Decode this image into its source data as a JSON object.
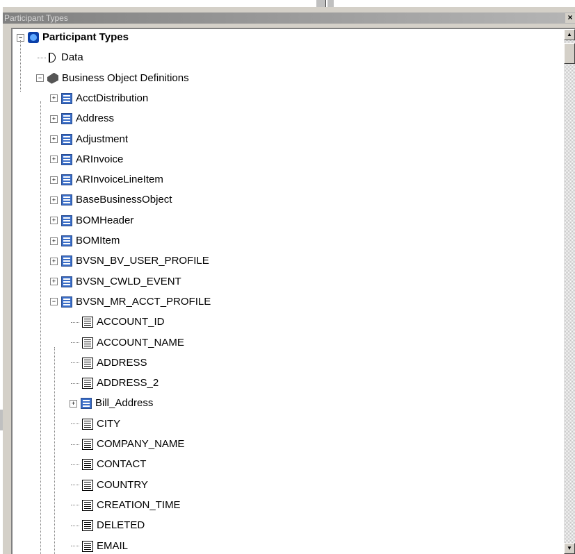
{
  "window": {
    "title": "Participant Types",
    "close_glyph": "×"
  },
  "tree": {
    "root": {
      "label": "Participant Types",
      "icon": "participant-root-icon",
      "expander": "−"
    },
    "items": [
      {
        "label": "Data",
        "icon": "data-icon",
        "level": 1
      },
      {
        "label": "Business Object Definitions",
        "icon": "business-objects-icon",
        "level": 1,
        "expander": "−"
      },
      {
        "label": "AcctDistribution",
        "icon": "bo-icon",
        "level": 2,
        "expander": "+"
      },
      {
        "label": "Address",
        "icon": "bo-icon",
        "level": 2,
        "expander": "+"
      },
      {
        "label": "Adjustment",
        "icon": "bo-icon",
        "level": 2,
        "expander": "+"
      },
      {
        "label": "ARInvoice",
        "icon": "bo-icon",
        "level": 2,
        "expander": "+"
      },
      {
        "label": "ARInvoiceLineItem",
        "icon": "bo-icon",
        "level": 2,
        "expander": "+"
      },
      {
        "label": "BaseBusinessObject",
        "icon": "bo-icon",
        "level": 2,
        "expander": "+"
      },
      {
        "label": "BOMHeader",
        "icon": "bo-icon",
        "level": 2,
        "expander": "+"
      },
      {
        "label": "BOMItem",
        "icon": "bo-icon",
        "level": 2,
        "expander": "+"
      },
      {
        "label": "BVSN_BV_USER_PROFILE",
        "icon": "bo-icon",
        "level": 2,
        "expander": "+"
      },
      {
        "label": "BVSN_CWLD_EVENT",
        "icon": "bo-icon",
        "level": 2,
        "expander": "+"
      },
      {
        "label": "BVSN_MR_ACCT_PROFILE",
        "icon": "bo-icon",
        "level": 2,
        "expander": "−"
      },
      {
        "label": "ACCOUNT_ID",
        "icon": "field-icon",
        "level": 3
      },
      {
        "label": "ACCOUNT_NAME",
        "icon": "field-icon",
        "level": 3
      },
      {
        "label": "ADDRESS",
        "icon": "field-icon",
        "level": 3
      },
      {
        "label": "ADDRESS_2",
        "icon": "field-icon",
        "level": 3
      },
      {
        "label": "Bill_Address",
        "icon": "bo-icon",
        "level": 3,
        "expander": "+"
      },
      {
        "label": "CITY",
        "icon": "field-icon",
        "level": 3
      },
      {
        "label": "COMPANY_NAME",
        "icon": "field-icon",
        "level": 3
      },
      {
        "label": "CONTACT",
        "icon": "field-icon",
        "level": 3
      },
      {
        "label": "COUNTRY",
        "icon": "field-icon",
        "level": 3
      },
      {
        "label": "CREATION_TIME",
        "icon": "field-icon",
        "level": 3
      },
      {
        "label": "DELETED",
        "icon": "field-icon",
        "level": 3
      },
      {
        "label": "EMAIL",
        "icon": "field-icon",
        "level": 3
      }
    ]
  },
  "scrollbar": {
    "up_glyph": "▲",
    "down_glyph": "▼"
  }
}
